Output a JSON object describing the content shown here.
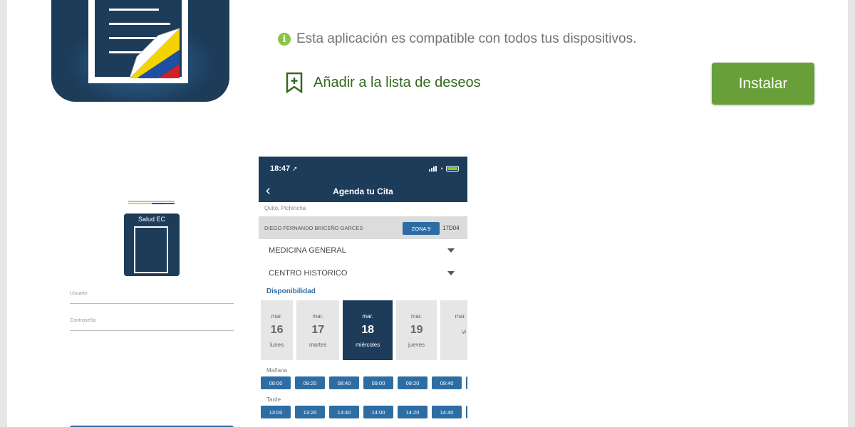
{
  "header": {
    "compat_text": "Esta aplicación es compatible con todos tus dispositivos.",
    "info_icon": "i",
    "wishlist_label": "Añadir a la lista de deseos",
    "install_label": "Instalar"
  },
  "colors": {
    "accent_green": "#689f38",
    "wishlist_green": "#33691e",
    "navy": "#1d3c5a",
    "app_blue": "#2e6da4"
  },
  "login_screen": {
    "app_label": "Salud EC",
    "user_placeholder": "Usuario",
    "password_placeholder": "Contraseña"
  },
  "phone": {
    "time": "18:47",
    "title": "Agenda tu Cita",
    "location": "Quito, Pichincha",
    "doctor": "DIEGO FERNANDO BRICEÑO GARCES",
    "zone": "ZONA 9",
    "code": "17D04",
    "specialty": "MEDICINA GENERAL",
    "center": "CENTRO HISTORICO",
    "availability_label": "Disponibilidad",
    "days": [
      {
        "month": "mar.",
        "day": "16",
        "weekday": "lunes"
      },
      {
        "month": "mar.",
        "day": "17",
        "weekday": "martes"
      },
      {
        "month": "mar.",
        "day": "18",
        "weekday": "miércoles"
      },
      {
        "month": "mar.",
        "day": "19",
        "weekday": "jueves"
      },
      {
        "month": "mar.",
        "day": "",
        "weekday": "vi"
      }
    ],
    "morning_label": "Mañana",
    "morning_slots": [
      "08:00",
      "08:20",
      "08:40",
      "09:00",
      "09:20",
      "09:40",
      ""
    ],
    "afternoon_label": "Tarde",
    "afternoon_slots": [
      "13:00",
      "13:20",
      "13:40",
      "14:00",
      "14:20",
      "14:40",
      ""
    ]
  }
}
